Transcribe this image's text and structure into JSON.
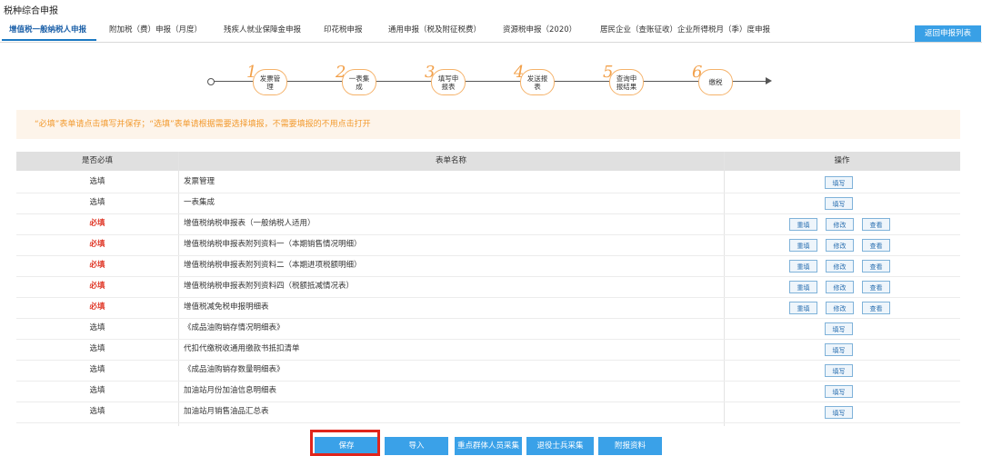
{
  "window": {
    "title": "税种综合申报"
  },
  "tabs": [
    "增值税一般纳税人申报",
    "附加税（费）申报（月度）",
    "残疾人就业保障金申报",
    "印花税申报",
    "通用申报（税及附征税费）",
    "资源税申报（2020）",
    "居民企业（查账征收）企业所得税月（季）度申报"
  ],
  "back_button": "返回申报列表",
  "steps": [
    {
      "num": "1",
      "label": "发票管理"
    },
    {
      "num": "2",
      "label": "一表集成"
    },
    {
      "num": "3",
      "label": "填写申报表"
    },
    {
      "num": "4",
      "label": "发送报表"
    },
    {
      "num": "5",
      "label": "查询申报结果"
    },
    {
      "num": "6",
      "label": "缴税"
    }
  ],
  "notice": "“必填”表单请点击填写并保存；“选填”表单请根据需要选择填报，不需要填报的不用点击打开",
  "table": {
    "headers": {
      "required": "是否必填",
      "name": "表单名称",
      "ops": "操作"
    },
    "rows": [
      {
        "required": "选填",
        "name": "发票管理",
        "ops": [
          "填写"
        ]
      },
      {
        "required": "选填",
        "name": "一表集成",
        "ops": [
          "填写"
        ]
      },
      {
        "required": "必填",
        "name": "增值税纳税申报表（一般纳税人适用）",
        "ops": [
          "重填",
          "修改",
          "查看"
        ]
      },
      {
        "required": "必填",
        "name": "增值税纳税申报表附列资料一（本期销售情况明细）",
        "ops": [
          "重填",
          "修改",
          "查看"
        ]
      },
      {
        "required": "必填",
        "name": "增值税纳税申报表附列资料二（本期进项税额明细）",
        "ops": [
          "重填",
          "修改",
          "查看"
        ]
      },
      {
        "required": "必填",
        "name": "增值税纳税申报表附列资料四（税额抵减情况表）",
        "ops": [
          "重填",
          "修改",
          "查看"
        ]
      },
      {
        "required": "必填",
        "name": "增值税减免税申报明细表",
        "ops": [
          "重填",
          "修改",
          "查看"
        ]
      },
      {
        "required": "选填",
        "name": "《成品油购销存情况明细表》",
        "ops": [
          "填写"
        ]
      },
      {
        "required": "选填",
        "name": "代扣代缴税收通用缴款书抵扣清单",
        "ops": [
          "填写"
        ]
      },
      {
        "required": "选填",
        "name": "《成品油购销存数量明细表》",
        "ops": [
          "填写"
        ]
      },
      {
        "required": "选填",
        "name": "加油站月份加油信息明细表",
        "ops": [
          "填写"
        ]
      },
      {
        "required": "选填",
        "name": "加油站月销售油品汇总表",
        "ops": [
          "填写"
        ]
      }
    ]
  },
  "bottom_buttons": {
    "save": "保存",
    "import": "导入",
    "key_group": "重点群体人员采集",
    "veteran": "退役士兵采集",
    "attachments": "附报资料"
  },
  "colors": {
    "accent": "#39a0e6",
    "step_orange": "#f2a04a",
    "required_red": "#e03a2a",
    "highlight_red": "#e0251c"
  }
}
